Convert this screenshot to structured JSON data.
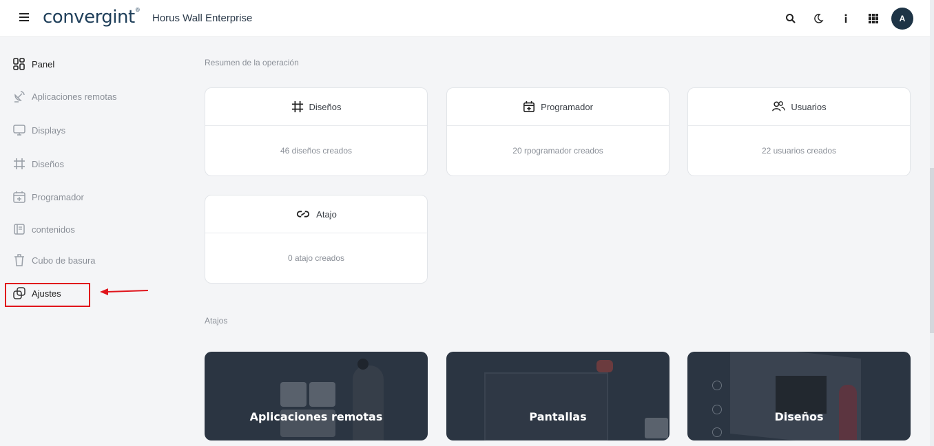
{
  "header": {
    "logo_text": "convergint",
    "app_title": "Horus Wall Enterprise",
    "avatar_initial": "A",
    "icons": [
      "search-icon",
      "moon-icon",
      "info-icon",
      "apps-grid-icon"
    ]
  },
  "sidebar": {
    "items": [
      {
        "label": "Panel",
        "icon": "dashboard-icon"
      },
      {
        "label": "Aplicaciones remotas",
        "icon": "satellite-icon"
      },
      {
        "label": "Displays",
        "icon": "monitor-icon"
      },
      {
        "label": "Diseños",
        "icon": "crop-icon"
      },
      {
        "label": "Programador",
        "icon": "calendar-plus-icon"
      },
      {
        "label": "contenidos",
        "icon": "content-icon"
      },
      {
        "label": "Cubo de basura",
        "icon": "trash-icon"
      },
      {
        "label": "Ajustes",
        "icon": "copy-icon"
      }
    ]
  },
  "overview": {
    "title": "Resumen de la operación",
    "cards": [
      {
        "title": "Diseños",
        "count_text": "46 diseños creados",
        "icon": "crop-icon"
      },
      {
        "title": "Programador",
        "count_text": "20 rpogramador creados",
        "icon": "calendar-plus-icon"
      },
      {
        "title": "Usuarios",
        "count_text": "22 usuarios creados",
        "icon": "users-icon"
      },
      {
        "title": "Atajo",
        "count_text": "0 atajo creados",
        "icon": "link-icon"
      }
    ]
  },
  "shortcuts": {
    "title": "Atajos",
    "items": [
      {
        "label": "Aplicaciones remotas"
      },
      {
        "label": "Pantallas"
      },
      {
        "label": "Diseños"
      }
    ]
  },
  "colors": {
    "highlight": "#e0141b",
    "logo": "#1f3f5a",
    "card_dark": "#2b3542"
  }
}
